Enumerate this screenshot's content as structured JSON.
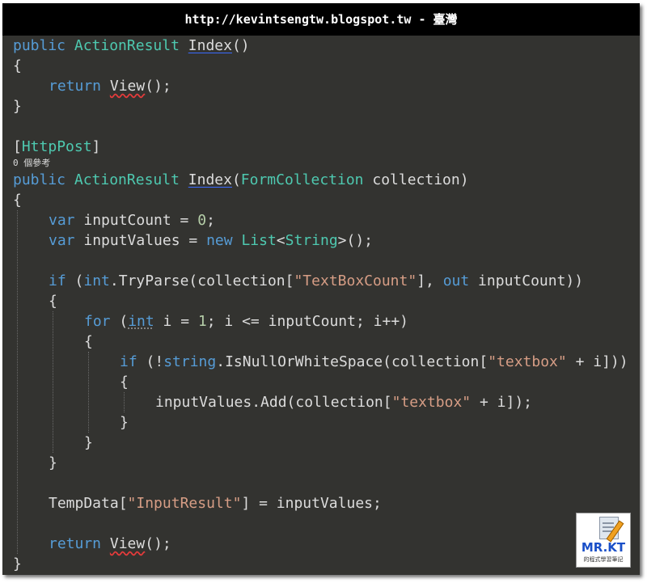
{
  "title": "http://kevintsengtw.blogspot.tw - 臺灣",
  "code_lines": [
    {
      "indent": 0,
      "tokens": [
        {
          "t": "public",
          "c": "kw"
        },
        {
          "t": " ",
          "c": "pl"
        },
        {
          "t": "ActionResult",
          "c": "ty"
        },
        {
          "t": " ",
          "c": "pl"
        },
        {
          "t": "Index",
          "c": "pl",
          "u": "blue"
        },
        {
          "t": "()",
          "c": "pl"
        }
      ]
    },
    {
      "indent": 0,
      "tokens": [
        {
          "t": "{",
          "c": "pl"
        }
      ]
    },
    {
      "indent": 1,
      "tokens": [
        {
          "t": "return",
          "c": "kw"
        },
        {
          "t": " ",
          "c": "pl"
        },
        {
          "t": "View",
          "c": "pl",
          "u": "red"
        },
        {
          "t": "();",
          "c": "pl"
        }
      ]
    },
    {
      "indent": 0,
      "tokens": [
        {
          "t": "}",
          "c": "pl"
        }
      ]
    },
    {
      "indent": 0,
      "tokens": []
    },
    {
      "indent": 0,
      "tokens": [
        {
          "t": "[",
          "c": "pl"
        },
        {
          "t": "HttpPost",
          "c": "ty"
        },
        {
          "t": "]",
          "c": "pl"
        }
      ]
    },
    {
      "indent": 0,
      "small": true,
      "tokens": [
        {
          "t": "0 個參考",
          "c": "pl"
        }
      ]
    },
    {
      "indent": 0,
      "tokens": [
        {
          "t": "public",
          "c": "kw"
        },
        {
          "t": " ",
          "c": "pl"
        },
        {
          "t": "ActionResult",
          "c": "ty"
        },
        {
          "t": " ",
          "c": "pl"
        },
        {
          "t": "Index",
          "c": "pl",
          "u": "blue"
        },
        {
          "t": "(",
          "c": "pl"
        },
        {
          "t": "FormCollection",
          "c": "ty"
        },
        {
          "t": " collection)",
          "c": "pl"
        }
      ]
    },
    {
      "indent": 0,
      "tokens": [
        {
          "t": "{",
          "c": "pl"
        }
      ]
    },
    {
      "indent": 1,
      "tokens": [
        {
          "t": "var",
          "c": "kw"
        },
        {
          "t": " inputCount = ",
          "c": "pl"
        },
        {
          "t": "0",
          "c": "nm"
        },
        {
          "t": ";",
          "c": "pl"
        }
      ]
    },
    {
      "indent": 1,
      "tokens": [
        {
          "t": "var",
          "c": "kw"
        },
        {
          "t": " inputValues = ",
          "c": "pl"
        },
        {
          "t": "new",
          "c": "kw"
        },
        {
          "t": " ",
          "c": "pl"
        },
        {
          "t": "List",
          "c": "ty"
        },
        {
          "t": "<",
          "c": "pl"
        },
        {
          "t": "String",
          "c": "ty"
        },
        {
          "t": ">();",
          "c": "pl"
        }
      ]
    },
    {
      "indent": 1,
      "tokens": []
    },
    {
      "indent": 1,
      "tokens": [
        {
          "t": "if",
          "c": "kw"
        },
        {
          "t": " (",
          "c": "pl"
        },
        {
          "t": "int",
          "c": "kw"
        },
        {
          "t": ".TryParse(collection[",
          "c": "pl"
        },
        {
          "t": "\"TextBoxCount\"",
          "c": "st"
        },
        {
          "t": "], ",
          "c": "pl"
        },
        {
          "t": "out",
          "c": "kw"
        },
        {
          "t": " inputCount))",
          "c": "pl"
        }
      ]
    },
    {
      "indent": 1,
      "tokens": [
        {
          "t": "{",
          "c": "pl"
        }
      ]
    },
    {
      "indent": 2,
      "tokens": [
        {
          "t": "for",
          "c": "kw"
        },
        {
          "t": " (",
          "c": "pl"
        },
        {
          "t": "int",
          "c": "kw",
          "u": "dots"
        },
        {
          "t": " i = ",
          "c": "pl"
        },
        {
          "t": "1",
          "c": "nm"
        },
        {
          "t": "; i <= inputCount; i++)",
          "c": "pl"
        }
      ]
    },
    {
      "indent": 2,
      "tokens": [
        {
          "t": "{",
          "c": "pl"
        }
      ]
    },
    {
      "indent": 3,
      "tokens": [
        {
          "t": "if",
          "c": "kw"
        },
        {
          "t": " (!",
          "c": "pl"
        },
        {
          "t": "string",
          "c": "kw"
        },
        {
          "t": ".IsNullOrWhiteSpace(collection[",
          "c": "pl"
        },
        {
          "t": "\"textbox\"",
          "c": "st"
        },
        {
          "t": " + i]))",
          "c": "pl"
        }
      ]
    },
    {
      "indent": 3,
      "tokens": [
        {
          "t": "{",
          "c": "pl"
        }
      ]
    },
    {
      "indent": 4,
      "tokens": [
        {
          "t": "inputValues.Add(collection[",
          "c": "pl"
        },
        {
          "t": "\"textbox\"",
          "c": "st"
        },
        {
          "t": " + i]);",
          "c": "pl"
        }
      ]
    },
    {
      "indent": 3,
      "tokens": [
        {
          "t": "}",
          "c": "pl"
        }
      ]
    },
    {
      "indent": 2,
      "tokens": [
        {
          "t": "}",
          "c": "pl"
        }
      ]
    },
    {
      "indent": 1,
      "tokens": [
        {
          "t": "}",
          "c": "pl"
        }
      ]
    },
    {
      "indent": 1,
      "tokens": []
    },
    {
      "indent": 1,
      "tokens": [
        {
          "t": "TempData[",
          "c": "pl"
        },
        {
          "t": "\"InputResult\"",
          "c": "st"
        },
        {
          "t": "] = inputValues;",
          "c": "pl"
        }
      ]
    },
    {
      "indent": 1,
      "tokens": []
    },
    {
      "indent": 1,
      "tokens": [
        {
          "t": "return",
          "c": "kw"
        },
        {
          "t": " ",
          "c": "pl"
        },
        {
          "t": "View",
          "c": "pl",
          "u": "red"
        },
        {
          "t": "();",
          "c": "pl"
        }
      ]
    },
    {
      "indent": 0,
      "tokens": [
        {
          "t": "}",
          "c": "pl"
        }
      ]
    }
  ],
  "logo": {
    "brand": "MR.KT",
    "subtitle": "的程式學習筆記",
    "icon": "document-pencil-icon"
  },
  "colors": {
    "background": "#333330",
    "keyword": "#569CD6",
    "type": "#4EC9B0",
    "string": "#D69D85",
    "number": "#B5CEA8",
    "text": "#DCDCDC"
  }
}
